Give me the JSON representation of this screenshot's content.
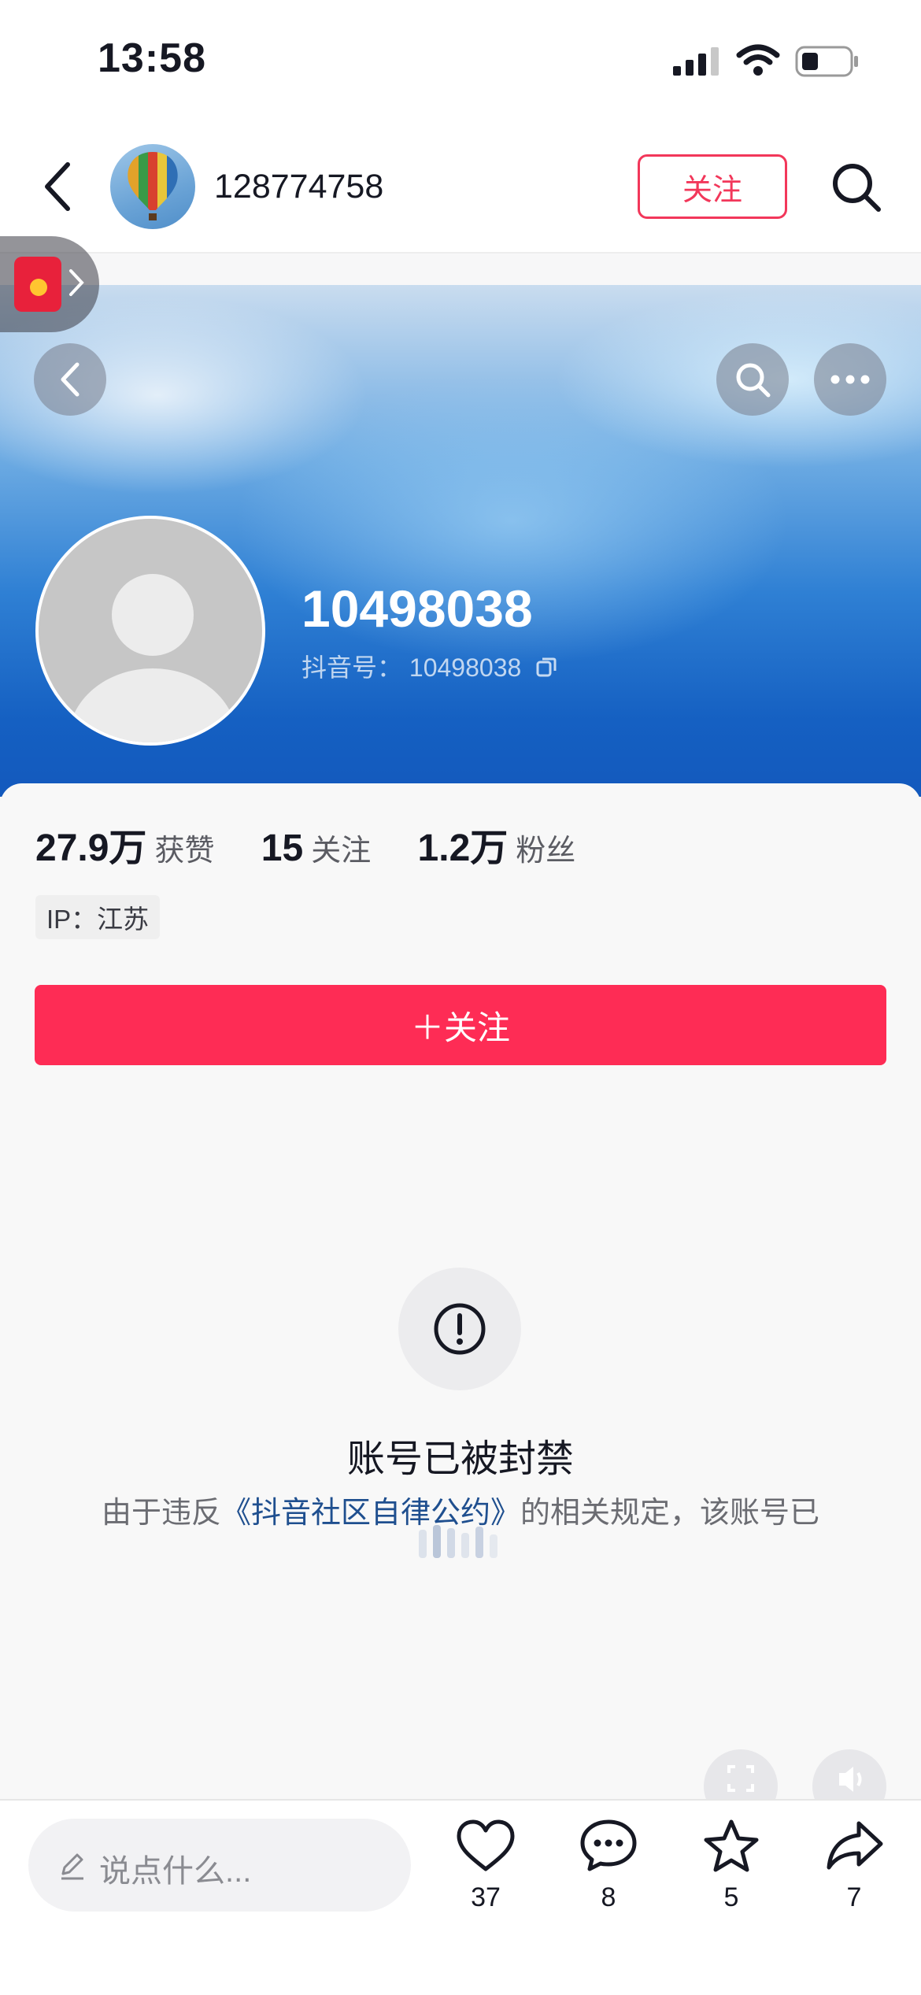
{
  "status_bar": {
    "time": "13:58"
  },
  "header": {
    "username": "128774758",
    "follow_label": "关注"
  },
  "profile": {
    "name": "10498038",
    "douyin_id_label": "抖音号：",
    "douyin_id": "10498038"
  },
  "stats": [
    {
      "value": "27.9万",
      "label": "获赞"
    },
    {
      "value": "15",
      "label": "关注"
    },
    {
      "value": "1.2万",
      "label": "粉丝"
    }
  ],
  "ip_location": "IP：江苏",
  "follow_button_label": "＋关注",
  "banned": {
    "title": "账号已被封禁",
    "text_prefix": "由于违反",
    "link": "《抖音社区自律公约》",
    "text_suffix": "的相关规定，该账号已"
  },
  "comment_placeholder": "说点什么...",
  "actions": {
    "like": {
      "icon": "heart-icon",
      "count": "37"
    },
    "comment": {
      "icon": "comment-icon",
      "count": "8"
    },
    "favorite": {
      "icon": "star-icon",
      "count": "5"
    },
    "share": {
      "icon": "share-icon",
      "count": "7"
    }
  },
  "colors": {
    "accent": "#fe2c55",
    "link": "#1f4f8f"
  }
}
